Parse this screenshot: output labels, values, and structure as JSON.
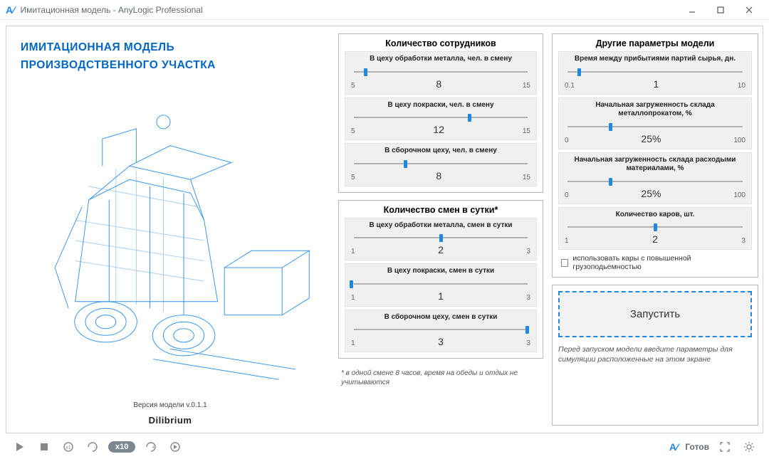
{
  "window": {
    "title": "Имитационная модель - AnyLogic Professional"
  },
  "left": {
    "title_line1": "ИМИТАЦИОННАЯ МОДЕЛЬ",
    "title_line2": "ПРОИЗВОДСТВЕННОГО УЧАСТКА",
    "version": "Версия модели v.0.1.1",
    "brand": "Dilibrium"
  },
  "employees": {
    "title": "Количество сотрудников",
    "params": [
      {
        "label": "В цеху обработки металла, чел. в смену",
        "min": "5",
        "max": "15",
        "value": "8",
        "thumb_pct": 8
      },
      {
        "label": "В цеху покраски, чел. в смену",
        "min": "5",
        "max": "15",
        "value": "12",
        "thumb_pct": 66
      },
      {
        "label": "В сборочном цеху, чел. в смену",
        "min": "5",
        "max": "15",
        "value": "8",
        "thumb_pct": 30
      }
    ]
  },
  "shifts": {
    "title": "Количество смен в сутки*",
    "params": [
      {
        "label": "В цеху обработки металла, смен в сутки",
        "min": "1",
        "max": "3",
        "value": "2",
        "thumb_pct": 50
      },
      {
        "label": "В цеху покраски, смен в сутки",
        "min": "1",
        "max": "3",
        "value": "1",
        "thumb_pct": 0
      },
      {
        "label": "В сборочном цеху, смен в сутки",
        "min": "1",
        "max": "3",
        "value": "3",
        "thumb_pct": 98
      }
    ],
    "footnote": "* в одной смене 8 часов, время на обеды и отдых не учитываются"
  },
  "other": {
    "title": "Другие параметры модели",
    "params": [
      {
        "label": "Время между прибытиями партий сырья, дн.",
        "min": "0.1",
        "max": "10",
        "value": "1",
        "thumb_pct": 8
      },
      {
        "label": "Начальная загруженность склада металлопрокатом, %",
        "min": "0",
        "max": "100",
        "value": "25%",
        "thumb_pct": 25
      },
      {
        "label": "Начальная загруженность склада расходыми материалами, %",
        "min": "0",
        "max": "100",
        "value": "25%",
        "thumb_pct": 25
      },
      {
        "label": "Количество каров, шт.",
        "min": "1",
        "max": "3",
        "value": "2",
        "thumb_pct": 50
      }
    ],
    "checkbox_label": "использовать кары с повышенной грузоподьемностью",
    "checkbox_checked": false
  },
  "run": {
    "button_label": "Запустить",
    "hint": "Перед запуском модели введите параметры для симуляции расположенные на этом экране"
  },
  "bottombar": {
    "speed_label": "x10",
    "status": "Готов"
  },
  "chart_data": null
}
